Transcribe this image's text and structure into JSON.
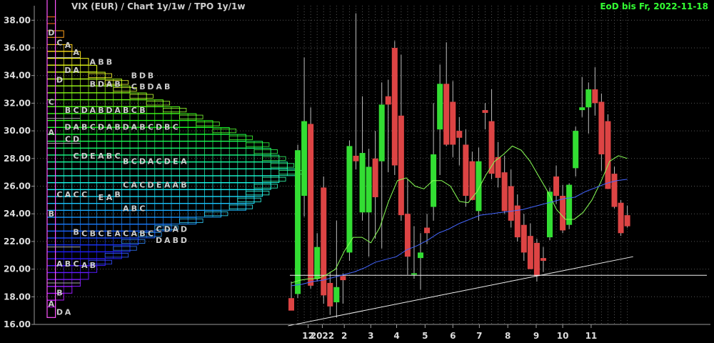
{
  "header": {
    "title": "VIX (EUR) /  Chart 1y/1w / TPO 1y/1w",
    "date_label": "EoD bis Fr, 2022-11-18",
    "title_color": "#cfcfcf",
    "date_color": "#33ff33"
  },
  "colors": {
    "up": "#33dd33",
    "down": "#dd4444",
    "sma_short": "#88ff55",
    "sma_long": "#4466ff",
    "grid": "#555555",
    "axis_text": "#dddddd"
  },
  "chart_data": {
    "type": "candlestick",
    "y_ticks": [
      "16.00",
      "18.00",
      "20.00",
      "22.00",
      "24.00",
      "26.00",
      "28.00",
      "30.00",
      "32.00",
      "34.00",
      "36.00",
      "38.00"
    ],
    "ylim": [
      16,
      39
    ],
    "x_ticks": [
      {
        "label": "12",
        "index": 2.6
      },
      {
        "label": "2022",
        "index": 4.8
      },
      {
        "label": "2",
        "index": 8.2
      },
      {
        "label": "3",
        "index": 12.3
      },
      {
        "label": "4",
        "index": 16.3
      },
      {
        "label": "5",
        "index": 20.7
      },
      {
        "label": "6",
        "index": 25
      },
      {
        "label": "7",
        "index": 29.1
      },
      {
        "label": "8",
        "index": 33.5
      },
      {
        "label": "9",
        "index": 37.9
      },
      {
        "label": "10",
        "index": 42
      },
      {
        "label": "11",
        "index": 46.4
      }
    ],
    "candles": [
      {
        "o": 17.9,
        "h": 19.1,
        "l": 17.2,
        "c": 17.0
      },
      {
        "o": 18.2,
        "h": 29.0,
        "l": 17.9,
        "c": 28.6
      },
      {
        "o": 25.3,
        "h": 35.3,
        "l": 23.8,
        "c": 30.7
      },
      {
        "o": 30.5,
        "h": 31.7,
        "l": 18.6,
        "c": 18.8
      },
      {
        "o": 19.3,
        "h": 22.6,
        "l": 19.1,
        "c": 21.6
      },
      {
        "o": 25.9,
        "h": 26.7,
        "l": 17.5,
        "c": 18.1
      },
      {
        "o": 19.0,
        "h": 19.8,
        "l": 16.7,
        "c": 17.3
      },
      {
        "o": 17.6,
        "h": 23.5,
        "l": 16.5,
        "c": 18.7
      },
      {
        "o": 19.5,
        "h": 19.7,
        "l": 17.5,
        "c": 19.2
      },
      {
        "o": 21.2,
        "h": 29.3,
        "l": 20.6,
        "c": 28.9
      },
      {
        "o": 28.2,
        "h": 38.5,
        "l": 27.2,
        "c": 27.8
      },
      {
        "o": 24.1,
        "h": 32.5,
        "l": 23.5,
        "c": 28.4
      },
      {
        "o": 24.1,
        "h": 28.7,
        "l": 20.9,
        "c": 27.4
      },
      {
        "o": 28.0,
        "h": 30.0,
        "l": 22.2,
        "c": 25.2
      },
      {
        "o": 27.8,
        "h": 33.5,
        "l": 21.5,
        "c": 31.9
      },
      {
        "o": 32.5,
        "h": 33.7,
        "l": 27.0,
        "c": 31.9
      },
      {
        "o": 36.0,
        "h": 36.5,
        "l": 26.8,
        "c": 27.5
      },
      {
        "o": 31.1,
        "h": 35.5,
        "l": 23.5,
        "c": 23.9
      },
      {
        "o": 24.0,
        "h": 26.5,
        "l": 19.6,
        "c": 20.9
      },
      {
        "o": 19.7,
        "h": 23.1,
        "l": 19.3,
        "c": 19.7
      },
      {
        "o": 20.8,
        "h": 22.6,
        "l": 18.5,
        "c": 21.2
      },
      {
        "o": 23.0,
        "h": 24.0,
        "l": 21.8,
        "c": 22.6
      },
      {
        "o": 24.5,
        "h": 32.0,
        "l": 23.5,
        "c": 28.3
      },
      {
        "o": 30.1,
        "h": 34.8,
        "l": 26.8,
        "c": 33.4
      },
      {
        "o": 33.4,
        "h": 36.4,
        "l": 28.9,
        "c": 29.0
      },
      {
        "o": 32.1,
        "h": 33.6,
        "l": 28.1,
        "c": 29.0
      },
      {
        "o": 30.0,
        "h": 31.0,
        "l": 27.5,
        "c": 29.5
      },
      {
        "o": 29.0,
        "h": 30.1,
        "l": 24.5,
        "c": 25.3
      },
      {
        "o": 27.8,
        "h": 28.5,
        "l": 25.0,
        "c": 25.0
      },
      {
        "o": 24.2,
        "h": 28.8,
        "l": 23.5,
        "c": 27.8
      },
      {
        "o": 31.5,
        "h": 32.0,
        "l": 30.1,
        "c": 31.3
      },
      {
        "o": 30.7,
        "h": 33.0,
        "l": 26.5,
        "c": 26.9
      },
      {
        "o": 28.1,
        "h": 29.2,
        "l": 25.9,
        "c": 26.6
      },
      {
        "o": 27.0,
        "h": 28.2,
        "l": 24.0,
        "c": 24.2
      },
      {
        "o": 26.0,
        "h": 27.2,
        "l": 23.0,
        "c": 23.5
      },
      {
        "o": 24.6,
        "h": 25.4,
        "l": 22.0,
        "c": 22.3
      },
      {
        "o": 23.2,
        "h": 24.0,
        "l": 20.6,
        "c": 21.2
      },
      {
        "o": 22.4,
        "h": 23.3,
        "l": 20.0,
        "c": 20.0
      },
      {
        "o": 21.9,
        "h": 22.2,
        "l": 19.1,
        "c": 19.5
      },
      {
        "o": 20.8,
        "h": 21.6,
        "l": 19.8,
        "c": 20.6
      },
      {
        "o": 22.3,
        "h": 25.9,
        "l": 22.1,
        "c": 25.6
      },
      {
        "o": 26.7,
        "h": 27.5,
        "l": 24.7,
        "c": 25.3
      },
      {
        "o": 25.3,
        "h": 26.1,
        "l": 22.6,
        "c": 22.8
      },
      {
        "o": 23.2,
        "h": 26.2,
        "l": 22.9,
        "c": 26.1
      },
      {
        "o": 27.3,
        "h": 30.3,
        "l": 26.7,
        "c": 30.0
      },
      {
        "o": 31.5,
        "h": 33.9,
        "l": 31.0,
        "c": 31.7
      },
      {
        "o": 31.7,
        "h": 33.5,
        "l": 29.8,
        "c": 33.0
      },
      {
        "o": 33.0,
        "h": 34.6,
        "l": 31.1,
        "c": 32.0
      },
      {
        "o": 32.1,
        "h": 32.7,
        "l": 27.1,
        "c": 28.3
      },
      {
        "o": 30.7,
        "h": 31.2,
        "l": 25.8,
        "c": 25.8
      },
      {
        "o": 26.9,
        "h": 27.4,
        "l": 24.4,
        "c": 24.5
      },
      {
        "o": 24.8,
        "h": 25.0,
        "l": 22.4,
        "c": 22.6
      },
      {
        "o": 23.9,
        "h": 24.6,
        "l": 23.0,
        "c": 23.1
      }
    ],
    "sma_short": [
      19.0,
      19.2,
      19.3,
      19.3,
      19.6,
      20.0,
      21.3,
      22.3,
      22.3,
      21.9,
      23.0,
      24.9,
      26.4,
      26.6,
      26.0,
      25.8,
      26.4,
      26.4,
      26.0,
      24.9,
      24.8,
      25.6,
      26.8,
      27.8,
      28.3,
      28.9,
      28.6,
      27.8,
      26.7,
      25.6,
      24.3,
      23.6,
      23.6,
      24.1,
      25.0,
      26.3,
      27.8,
      28.2,
      28.0
    ],
    "sma_long": [
      18.8,
      18.9,
      19.1,
      19.2,
      19.4,
      19.6,
      19.8,
      20.1,
      20.5,
      20.7,
      20.9,
      21.4,
      21.7,
      22.1,
      22.6,
      22.9,
      23.3,
      23.6,
      23.9,
      24.0,
      24.1,
      24.2,
      24.3,
      24.5,
      24.7,
      24.9,
      25.1,
      25.2,
      25.6,
      25.9,
      26.2,
      26.4,
      26.5
    ],
    "horizontal_line": 19.55,
    "trendline": [
      [
        -0.5,
        15.9
      ],
      [
        52.9,
        20.9
      ]
    ],
    "tpo": {
      "tick": 0.2,
      "top_price": 39.7,
      "column_letters": [
        "D",
        "C",
        "A",
        "B",
        "D",
        "A",
        "C",
        "A",
        "B",
        "A"
      ],
      "rows": [
        {
          "p": 38.0,
          "w": 1
        },
        {
          "p": 37.0,
          "w": 2
        },
        {
          "p": 36.0,
          "w": 3
        },
        {
          "p": 35.5,
          "w": 4
        },
        {
          "p": 35.0,
          "w": 5
        },
        {
          "p": 34.5,
          "w": 6
        },
        {
          "p": 34.0,
          "w": 7
        },
        {
          "p": 33.5,
          "w": 9
        },
        {
          "p": 33.0,
          "w": 10
        },
        {
          "p": 32.5,
          "w": 12
        },
        {
          "p": 32.0,
          "w": 14
        },
        {
          "p": 31.5,
          "w": 16
        },
        {
          "p": 31.0,
          "w": 18
        },
        {
          "p": 30.5,
          "w": 20
        },
        {
          "p": 30.0,
          "w": 22
        },
        {
          "p": 29.5,
          "w": 24
        },
        {
          "p": 29.0,
          "w": 26
        },
        {
          "p": 28.5,
          "w": 27
        },
        {
          "p": 28.0,
          "w": 28
        },
        {
          "p": 27.5,
          "w": 29
        },
        {
          "p": 27.0,
          "w": 30
        },
        {
          "p": 26.5,
          "w": 28
        },
        {
          "p": 26.0,
          "w": 27
        },
        {
          "p": 25.5,
          "w": 26
        },
        {
          "p": 25.0,
          "w": 25
        },
        {
          "p": 24.5,
          "w": 24
        },
        {
          "p": 24.0,
          "w": 21
        },
        {
          "p": 23.5,
          "w": 18
        },
        {
          "p": 23.0,
          "w": 15
        },
        {
          "p": 22.5,
          "w": 13
        },
        {
          "p": 22.0,
          "w": 11
        },
        {
          "p": 21.5,
          "w": 10
        },
        {
          "p": 21.0,
          "w": 9
        },
        {
          "p": 20.5,
          "w": 7
        },
        {
          "p": 20.0,
          "w": 6
        },
        {
          "p": 19.5,
          "w": 5
        },
        {
          "p": 19.0,
          "w": 4
        },
        {
          "p": 18.5,
          "w": 3
        },
        {
          "p": 18.0,
          "w": 2
        },
        {
          "p": 17.5,
          "w": 1
        }
      ],
      "labels": [
        {
          "t": "D",
          "p": 37.1,
          "c": 0
        },
        {
          "t": "C",
          "p": 36.4,
          "c": 1
        },
        {
          "t": "A",
          "p": 36.2,
          "c": 2
        },
        {
          "t": "A",
          "p": 35.7,
          "c": 3
        },
        {
          "t": "D",
          "p": 33.7,
          "c": 1
        },
        {
          "t": "C",
          "p": 32.1,
          "c": 0
        },
        {
          "t": "D",
          "p": 34.4,
          "c": 2
        },
        {
          "t": "A",
          "p": 34.4,
          "c": 3
        },
        {
          "t": "A",
          "p": 35.0,
          "c": 5
        },
        {
          "t": "B",
          "p": 35.0,
          "c": 6
        },
        {
          "t": "B",
          "p": 35.0,
          "c": 7
        },
        {
          "t": "B",
          "p": 33.4,
          "c": 5
        },
        {
          "t": "D",
          "p": 33.4,
          "c": 6
        },
        {
          "t": "A",
          "p": 33.4,
          "c": 7
        },
        {
          "t": "B",
          "p": 33.4,
          "c": 8
        },
        {
          "t": "B",
          "p": 34.0,
          "c": 10
        },
        {
          "t": "D",
          "p": 34.0,
          "c": 11
        },
        {
          "t": "B",
          "p": 34.0,
          "c": 12
        },
        {
          "t": "C",
          "p": 33.2,
          "c": 10
        },
        {
          "t": "B",
          "p": 33.2,
          "c": 11
        },
        {
          "t": "D",
          "p": 33.2,
          "c": 12
        },
        {
          "t": "A",
          "p": 33.2,
          "c": 13
        },
        {
          "t": "B",
          "p": 33.2,
          "c": 14
        },
        {
          "t": "B",
          "p": 31.5,
          "c": 2
        },
        {
          "t": "C",
          "p": 31.5,
          "c": 3
        },
        {
          "t": "D",
          "p": 31.5,
          "c": 4
        },
        {
          "t": "A",
          "p": 31.5,
          "c": 5
        },
        {
          "t": "B",
          "p": 31.5,
          "c": 6
        },
        {
          "t": "D",
          "p": 31.5,
          "c": 7
        },
        {
          "t": "A",
          "p": 31.5,
          "c": 8
        },
        {
          "t": "B",
          "p": 31.5,
          "c": 9
        },
        {
          "t": "C",
          "p": 31.5,
          "c": 10
        },
        {
          "t": "B",
          "p": 31.5,
          "c": 11
        },
        {
          "t": "A",
          "p": 29.9,
          "c": 0
        },
        {
          "t": "D",
          "p": 30.3,
          "c": 2
        },
        {
          "t": "A",
          "p": 30.3,
          "c": 3
        },
        {
          "t": "B",
          "p": 30.3,
          "c": 4
        },
        {
          "t": "C",
          "p": 30.3,
          "c": 5
        },
        {
          "t": "D",
          "p": 30.3,
          "c": 6
        },
        {
          "t": "A",
          "p": 30.3,
          "c": 7
        },
        {
          "t": "B",
          "p": 30.3,
          "c": 8
        },
        {
          "t": "D",
          "p": 30.3,
          "c": 9
        },
        {
          "t": "A",
          "p": 30.3,
          "c": 10
        },
        {
          "t": "B",
          "p": 30.3,
          "c": 11
        },
        {
          "t": "C",
          "p": 30.3,
          "c": 12
        },
        {
          "t": "D",
          "p": 30.3,
          "c": 13
        },
        {
          "t": "B",
          "p": 30.3,
          "c": 14
        },
        {
          "t": "C",
          "p": 30.3,
          "c": 15
        },
        {
          "t": "C",
          "p": 29.4,
          "c": 2
        },
        {
          "t": "D",
          "p": 29.4,
          "c": 3
        },
        {
          "t": "C",
          "p": 28.2,
          "c": 3
        },
        {
          "t": "D",
          "p": 28.2,
          "c": 4
        },
        {
          "t": "E",
          "p": 28.2,
          "c": 5
        },
        {
          "t": "A",
          "p": 28.2,
          "c": 6
        },
        {
          "t": "B",
          "p": 28.2,
          "c": 7
        },
        {
          "t": "C",
          "p": 28.2,
          "c": 8
        },
        {
          "t": "B",
          "p": 27.8,
          "c": 9
        },
        {
          "t": "C",
          "p": 27.8,
          "c": 10
        },
        {
          "t": "D",
          "p": 27.8,
          "c": 11
        },
        {
          "t": "A",
          "p": 27.8,
          "c": 12
        },
        {
          "t": "C",
          "p": 27.8,
          "c": 13
        },
        {
          "t": "D",
          "p": 27.8,
          "c": 14
        },
        {
          "t": "E",
          "p": 27.8,
          "c": 15
        },
        {
          "t": "A",
          "p": 27.8,
          "c": 16
        },
        {
          "t": "C",
          "p": 26.1,
          "c": 9
        },
        {
          "t": "A",
          "p": 26.1,
          "c": 10
        },
        {
          "t": "C",
          "p": 26.1,
          "c": 11
        },
        {
          "t": "D",
          "p": 26.1,
          "c": 12
        },
        {
          "t": "E",
          "p": 26.1,
          "c": 13
        },
        {
          "t": "A",
          "p": 26.1,
          "c": 14
        },
        {
          "t": "A",
          "p": 26.1,
          "c": 15
        },
        {
          "t": "B",
          "p": 26.1,
          "c": 16
        },
        {
          "t": "C",
          "p": 25.4,
          "c": 1
        },
        {
          "t": "A",
          "p": 25.4,
          "c": 2
        },
        {
          "t": "C",
          "p": 25.4,
          "c": 3
        },
        {
          "t": "C",
          "p": 25.4,
          "c": 4
        },
        {
          "t": "E",
          "p": 25.2,
          "c": 6
        },
        {
          "t": "A",
          "p": 25.2,
          "c": 7
        },
        {
          "t": "B",
          "p": 25.4,
          "c": 8
        },
        {
          "t": "A",
          "p": 24.4,
          "c": 9
        },
        {
          "t": "B",
          "p": 24.4,
          "c": 10
        },
        {
          "t": "C",
          "p": 24.4,
          "c": 11
        },
        {
          "t": "B",
          "p": 24.0,
          "c": 0
        },
        {
          "t": "B",
          "p": 22.7,
          "c": 3
        },
        {
          "t": "C",
          "p": 22.6,
          "c": 4
        },
        {
          "t": "B",
          "p": 22.6,
          "c": 5
        },
        {
          "t": "C",
          "p": 22.6,
          "c": 6
        },
        {
          "t": "E",
          "p": 22.6,
          "c": 7
        },
        {
          "t": "A",
          "p": 22.6,
          "c": 8
        },
        {
          "t": "C",
          "p": 22.6,
          "c": 9
        },
        {
          "t": "A",
          "p": 22.6,
          "c": 10
        },
        {
          "t": "B",
          "p": 22.6,
          "c": 11
        },
        {
          "t": "C",
          "p": 22.6,
          "c": 12
        },
        {
          "t": "C",
          "p": 22.9,
          "c": 13
        },
        {
          "t": "D",
          "p": 22.9,
          "c": 14
        },
        {
          "t": "A",
          "p": 22.9,
          "c": 15
        },
        {
          "t": "D",
          "p": 22.9,
          "c": 16
        },
        {
          "t": "D",
          "p": 22.1,
          "c": 13
        },
        {
          "t": "A",
          "p": 22.1,
          "c": 14
        },
        {
          "t": "B",
          "p": 22.1,
          "c": 15
        },
        {
          "t": "D",
          "p": 22.1,
          "c": 16
        },
        {
          "t": "A",
          "p": 20.4,
          "c": 1
        },
        {
          "t": "B",
          "p": 20.4,
          "c": 2
        },
        {
          "t": "C",
          "p": 20.4,
          "c": 3
        },
        {
          "t": "A",
          "p": 20.3,
          "c": 4
        },
        {
          "t": "B",
          "p": 20.3,
          "c": 5
        },
        {
          "t": "B",
          "p": 18.3,
          "c": 1
        },
        {
          "t": "A",
          "p": 17.5,
          "c": 0
        },
        {
          "t": "D",
          "p": 16.9,
          "c": 1
        },
        {
          "t": "A",
          "p": 16.9,
          "c": 2
        }
      ]
    }
  }
}
